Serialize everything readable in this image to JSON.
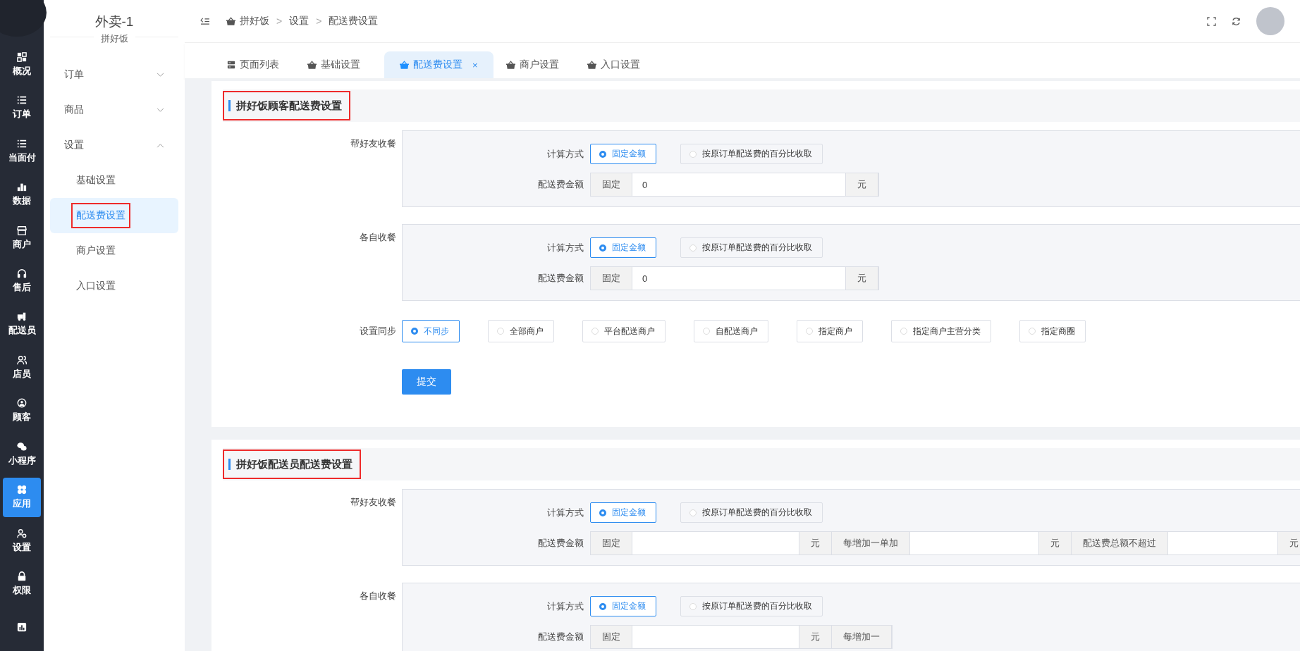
{
  "rail": {
    "items": [
      {
        "label": "概况",
        "selected": false
      },
      {
        "label": "订单",
        "selected": false
      },
      {
        "label": "当面付",
        "selected": false
      },
      {
        "label": "数据",
        "selected": false
      },
      {
        "label": "商户",
        "selected": false
      },
      {
        "label": "售后",
        "selected": false
      },
      {
        "label": "配送员",
        "selected": false
      },
      {
        "label": "店员",
        "selected": false
      },
      {
        "label": "顾客",
        "selected": false
      },
      {
        "label": "小程序",
        "selected": false
      },
      {
        "label": "应用",
        "selected": true
      },
      {
        "label": "设置",
        "selected": false
      },
      {
        "label": "权限",
        "selected": false
      },
      {
        "selected": false
      }
    ]
  },
  "sidebar": {
    "title": "外卖-1",
    "subtitle": "拼好饭",
    "items": [
      {
        "label": "订单",
        "expanded": false
      },
      {
        "label": "商品",
        "expanded": false
      },
      {
        "label": "设置",
        "expanded": true,
        "children": [
          {
            "label": "基础设置",
            "selected": false
          },
          {
            "label": "配送费设置",
            "selected": true,
            "highlighted": true
          },
          {
            "label": "商户设置",
            "selected": false
          },
          {
            "label": "入口设置",
            "selected": false
          }
        ]
      }
    ]
  },
  "breadcrumb": [
    {
      "label": "拼好饭"
    },
    {
      "separator": ">",
      "label": "设置"
    },
    {
      "separator": ">",
      "label": "配送费设置"
    }
  ],
  "tabs": [
    {
      "label": "页面列表",
      "selected": false
    },
    {
      "label": "基础设置",
      "selected": false
    },
    {
      "label": "配送费设置",
      "selected": true,
      "close": "×"
    },
    {
      "label": "商户设置",
      "selected": false
    },
    {
      "label": "入口设置",
      "selected": false
    }
  ],
  "sections": [
    {
      "title": "拼好饭顾客配送费设置",
      "highlighted": true,
      "groups": [
        {
          "label": "帮好友收餐",
          "method_label": "计算方式",
          "methods": [
            {
              "label": "固定金额",
              "selected": true
            },
            {
              "label": "按原订单配送费的百分比收取",
              "selected": false
            }
          ],
          "amount_label": "配送费金额",
          "amount_parts": [
            {
              "kind": "addon",
              "text": "固定"
            },
            {
              "kind": "input",
              "value": "0"
            },
            {
              "kind": "addon",
              "text": "元"
            }
          ]
        },
        {
          "label": "各自收餐",
          "method_label": "计算方式",
          "methods": [
            {
              "label": "固定金额",
              "selected": true
            },
            {
              "label": "按原订单配送费的百分比收取",
              "selected": false
            }
          ],
          "amount_label": "配送费金额",
          "amount_parts": [
            {
              "kind": "addon",
              "text": "固定"
            },
            {
              "kind": "input",
              "value": "0"
            },
            {
              "kind": "addon",
              "text": "元"
            }
          ]
        }
      ],
      "sync": {
        "label": "设置同步",
        "options": [
          {
            "label": "不同步",
            "selected": true
          },
          {
            "label": "全部商户",
            "selected": false
          },
          {
            "label": "平台配送商户",
            "selected": false
          },
          {
            "label": "自配送商户",
            "selected": false
          },
          {
            "label": "指定商户",
            "selected": false
          },
          {
            "label": "指定商户主营分类",
            "selected": false
          },
          {
            "label": "指定商圈",
            "selected": false
          }
        ]
      },
      "submit": "提交"
    },
    {
      "title": "拼好饭配送员配送费设置",
      "highlighted": true,
      "groups": [
        {
          "label": "帮好友收餐",
          "method_label": "计算方式",
          "methods": [
            {
              "label": "固定金额",
              "selected": true
            },
            {
              "label": "按原订单配送费的百分比收取",
              "selected": false
            }
          ],
          "amount_label": "配送费金额",
          "amount_parts": [
            {
              "kind": "addon",
              "text": "固定"
            },
            {
              "kind": "input"
            },
            {
              "kind": "addon",
              "text": "元"
            },
            {
              "kind": "addon",
              "text": "每增加一单加"
            },
            {
              "kind": "input"
            },
            {
              "kind": "addon",
              "text": "元"
            },
            {
              "kind": "addon",
              "text": "配送费总额不超过"
            },
            {
              "kind": "input"
            },
            {
              "kind": "addon",
              "text": "元"
            }
          ]
        },
        {
          "label": "各自收餐",
          "method_label": "计算方式",
          "methods": [
            {
              "label": "固定金额",
              "selected": true
            },
            {
              "label": "按原订单配送费的百分比收取",
              "selected": false
            }
          ],
          "amount_label": "配送费金额",
          "amount_parts": [
            {
              "kind": "addon",
              "text": "固定"
            },
            {
              "kind": "input"
            },
            {
              "kind": "addon",
              "text": "元"
            },
            {
              "kind": "addon",
              "text": "每增加一"
            }
          ]
        }
      ]
    }
  ]
}
